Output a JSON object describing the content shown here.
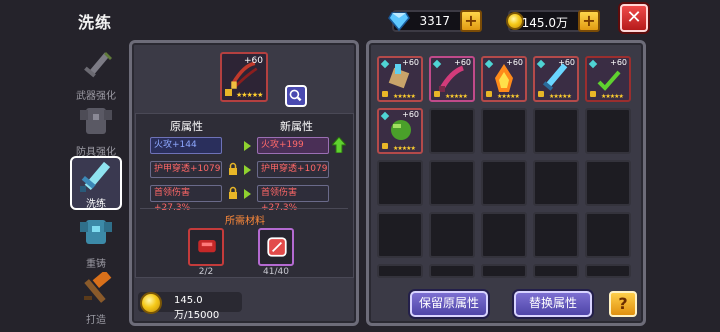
{
  "header": {
    "title": "洗练",
    "gems": "3317",
    "gold": "145.0万",
    "close_label": "✕"
  },
  "tabs": [
    {
      "label": "武器强化"
    },
    {
      "label": "防具强化"
    },
    {
      "label": "洗练"
    },
    {
      "label": "重铸"
    },
    {
      "label": "打造"
    }
  ],
  "refine": {
    "item_level": "+60",
    "original_header": "原属性",
    "new_header": "新属性",
    "rows": [
      {
        "original": "火攻+144",
        "new": "火攻+199"
      },
      {
        "original": "护甲穿透+1079",
        "new": "护甲穿透+1079"
      },
      {
        "original": "首领伤害+27.3%",
        "new": "首领伤害+27.3%"
      }
    ],
    "materials_label": "所需材料",
    "materials": [
      {
        "count": "2/2"
      },
      {
        "count": "41/40"
      }
    ],
    "gold_cost": "145.0万/15000"
  },
  "inventory": {
    "items": [
      {
        "level": "+60",
        "stars": "★★★★★"
      },
      {
        "level": "+60",
        "stars": "★★★★★"
      },
      {
        "level": "+60",
        "stars": "★★★★★"
      },
      {
        "level": "+60",
        "stars": "★★★★★"
      },
      {
        "level": "+60",
        "stars": "★★★★★"
      },
      {
        "level": "+60",
        "stars": "★★★★★"
      }
    ]
  },
  "actions": {
    "keep_label": "保留原属性",
    "replace_label": "替换属性",
    "help_label": "?"
  },
  "colors": {
    "accent": "#7c6fd1",
    "gold": "#f5c919",
    "increase": "#8fd12f",
    "close": "#d62a2a"
  }
}
